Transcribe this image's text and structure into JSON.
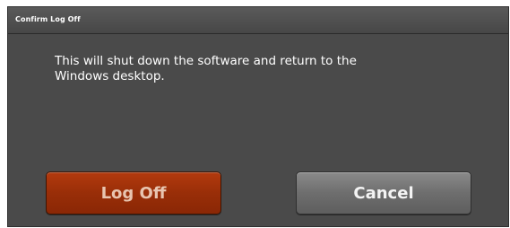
{
  "dialog": {
    "title": "Confirm Log Off",
    "message": "This will shut down the software and return to the Windows desktop.",
    "buttons": {
      "log_off_label": "Log Off",
      "cancel_label": "Cancel"
    }
  },
  "colors": {
    "dialog_background": "#4a4a4a",
    "log_off_button": "#992e08",
    "cancel_button": "#6e6e6e",
    "text": "#ffffff"
  }
}
